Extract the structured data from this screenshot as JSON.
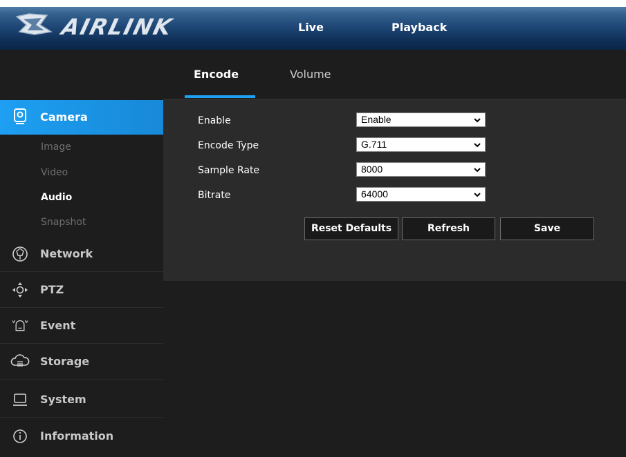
{
  "brand": {
    "name": "AIRLINK"
  },
  "header": {
    "nav": {
      "live": "Live",
      "playback": "Playback"
    }
  },
  "sidebar": {
    "active_section": "Camera",
    "sub_items": [
      "Image",
      "Video",
      "Audio",
      "Snapshot"
    ],
    "active_sub_item": "Audio",
    "menu": [
      {
        "label": "Network",
        "icon": "network-icon"
      },
      {
        "label": "PTZ",
        "icon": "ptz-icon"
      },
      {
        "label": "Event",
        "icon": "event-alarm-icon"
      },
      {
        "label": "Storage",
        "icon": "storage-cloud-icon"
      },
      {
        "label": "System",
        "icon": "system-monitor-icon"
      },
      {
        "label": "Information",
        "icon": "info-icon"
      }
    ]
  },
  "tabs": {
    "encode": "Encode",
    "volume": "Volume",
    "active": "Encode"
  },
  "form": {
    "enable": {
      "label": "Enable",
      "value": "Enable"
    },
    "encode_type": {
      "label": "Encode Type",
      "value": "G.711"
    },
    "sample_rate": {
      "label": "Sample Rate",
      "value": "8000"
    },
    "bitrate": {
      "label": "Bitrate",
      "value": "64000"
    }
  },
  "buttons": {
    "reset": "Reset Defaults",
    "refresh": "Refresh",
    "save": "Save"
  },
  "colors": {
    "accent": "#1e9ff2",
    "header": "#1f4877",
    "background": "#1d1d1d",
    "panel": "#2b2b2b"
  }
}
